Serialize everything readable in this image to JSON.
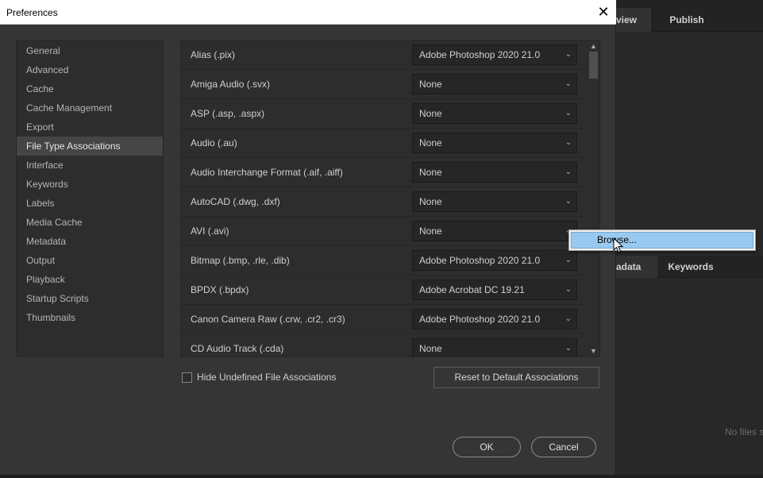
{
  "dialog": {
    "title": "Preferences",
    "close_glyph": "✕"
  },
  "sidebar": {
    "items": [
      {
        "label": "General"
      },
      {
        "label": "Advanced"
      },
      {
        "label": "Cache"
      },
      {
        "label": "Cache Management"
      },
      {
        "label": "Export"
      },
      {
        "label": "File Type Associations",
        "selected": true
      },
      {
        "label": "Interface"
      },
      {
        "label": "Keywords"
      },
      {
        "label": "Labels"
      },
      {
        "label": "Media Cache"
      },
      {
        "label": "Metadata"
      },
      {
        "label": "Output"
      },
      {
        "label": "Playback"
      },
      {
        "label": "Startup Scripts"
      },
      {
        "label": "Thumbnails"
      }
    ]
  },
  "associations": {
    "rows": [
      {
        "label": "Alias (.pix)",
        "value": "Adobe Photoshop 2020 21.0"
      },
      {
        "label": "Amiga Audio (.svx)",
        "value": "None"
      },
      {
        "label": "ASP (.asp, .aspx)",
        "value": "None"
      },
      {
        "label": "Audio (.au)",
        "value": "None"
      },
      {
        "label": "Audio Interchange Format (.aif, .aiff)",
        "value": "None"
      },
      {
        "label": "AutoCAD (.dwg, .dxf)",
        "value": "None"
      },
      {
        "label": "AVI (.avi)",
        "value": "None"
      },
      {
        "label": "Bitmap (.bmp, .rle, .dib)",
        "value": "Adobe Photoshop 2020 21.0"
      },
      {
        "label": "BPDX (.bpdx)",
        "value": "Adobe Acrobat DC 19.21"
      },
      {
        "label": "Canon Camera Raw (.crw, .cr2, .cr3)",
        "value": "Adobe Photoshop 2020 21.0"
      },
      {
        "label": "CD Audio Track (.cda)",
        "value": "None"
      }
    ],
    "chevron_glyph": "⌄"
  },
  "options": {
    "hide_undefined_label": "Hide Undefined File Associations",
    "hide_undefined_checked": false,
    "reset_label": "Reset to Default Associations"
  },
  "footer": {
    "ok_label": "OK",
    "cancel_label": "Cancel"
  },
  "popup": {
    "item_label": "Browse..."
  },
  "background_app": {
    "tabs_top": [
      {
        "label": "view",
        "active": true
      },
      {
        "label": "Publish",
        "active": false
      }
    ],
    "tabs_mid": [
      {
        "label": "adata",
        "active": true
      },
      {
        "label": "Keywords",
        "active": false
      }
    ],
    "empty_text": "No files s"
  },
  "colors": {
    "dialog_bg": "#353535",
    "panel_bg": "#2d2d2d",
    "selected_item_bg": "#454545",
    "popup_highlight": "#99c9ef"
  }
}
